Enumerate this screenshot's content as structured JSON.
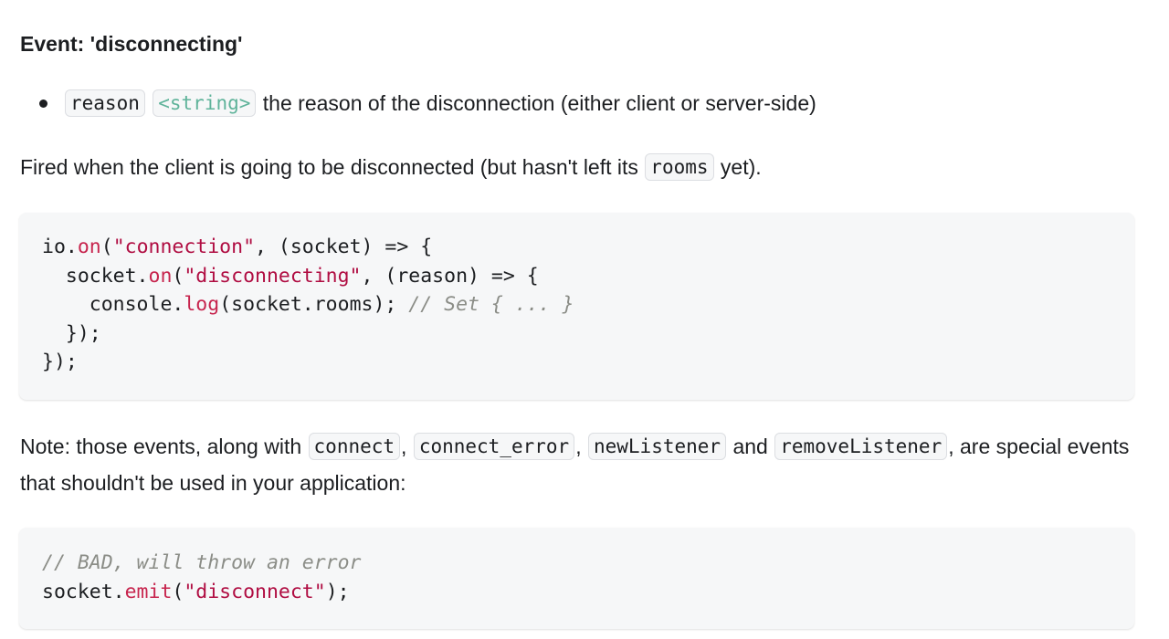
{
  "event_heading": "Event: 'disconnecting'",
  "params": [
    {
      "name": "reason",
      "type": "<string>",
      "description": " the reason of the disconnection (either client or server-side)"
    }
  ],
  "paragraph1": {
    "text_before": "Fired when the client is going to be disconnected (but hasn't left its ",
    "code": "rooms",
    "text_after": " yet)."
  },
  "code_block_1": {
    "lines": [
      [
        {
          "t": "io.",
          "k": "plain"
        },
        {
          "t": "on",
          "k": "fn"
        },
        {
          "t": "(",
          "k": "plain"
        },
        {
          "t": "\"connection\"",
          "k": "str"
        },
        {
          "t": ", (socket) => {",
          "k": "plain"
        }
      ],
      [
        {
          "t": "  socket.",
          "k": "plain"
        },
        {
          "t": "on",
          "k": "fn"
        },
        {
          "t": "(",
          "k": "plain"
        },
        {
          "t": "\"disconnecting\"",
          "k": "str"
        },
        {
          "t": ", (reason) => {",
          "k": "plain"
        }
      ],
      [
        {
          "t": "    console.",
          "k": "plain"
        },
        {
          "t": "log",
          "k": "fn"
        },
        {
          "t": "(socket.rooms); ",
          "k": "plain"
        },
        {
          "t": "// Set { ... }",
          "k": "cm"
        }
      ],
      [
        {
          "t": "  });",
          "k": "plain"
        }
      ],
      [
        {
          "t": "});",
          "k": "plain"
        }
      ]
    ]
  },
  "paragraph2": {
    "text_1": "Note: those events, along with ",
    "code_1": "connect",
    "text_2": ", ",
    "code_2": "connect_error",
    "text_3": ", ",
    "code_3": "newListener",
    "text_4": " and ",
    "code_4": "removeListener",
    "text_5": ", are special events that shouldn't be used in your application:"
  },
  "code_block_2": {
    "lines": [
      [
        {
          "t": "// BAD, will throw an error",
          "k": "cm"
        }
      ],
      [
        {
          "t": "socket.",
          "k": "plain"
        },
        {
          "t": "emit",
          "k": "fn"
        },
        {
          "t": "(",
          "k": "plain"
        },
        {
          "t": "\"disconnect\"",
          "k": "str"
        },
        {
          "t": ");",
          "k": "plain"
        }
      ]
    ]
  }
}
